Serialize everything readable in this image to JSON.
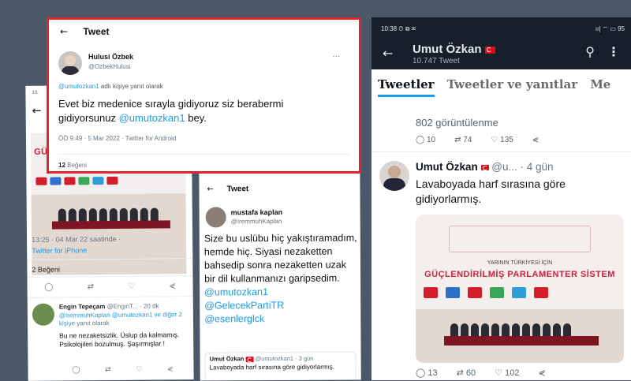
{
  "left_card": {
    "status_time": "13:",
    "back_icon": "←",
    "photo_banner": "GÜ",
    "time": "13:25 · 04 Mar 22 saatinde ·",
    "source": "Twitter for iPhone",
    "likes": "2 Beğeni",
    "reply": {
      "name": "Engin Tepeçam",
      "handle_date": "@EnginT... · 20 dk",
      "replying_prefix": "@IremmuhKaplan @umutozkan1 ve",
      "replying_more": "diğer 2 kişiye",
      "replying_suffix": " yanıt olarak",
      "text": "Bu ne nezaketsizlik. Üslup da kalmamış. Psikolojileri bozulmuş. Şaşırmışlar !"
    }
  },
  "top_card": {
    "header": "Tweet",
    "name": "Hulusi Özbek",
    "handle": "@OzbekHulusi",
    "replying_handle": "@umutozkan1",
    "replying_suffix": " adlı kişiye yanıt olarak",
    "body_text": "Evet biz medenice sırayla gidiyoruz siz berabermi gidiyorsunuz ",
    "body_mention": "@umutozkan1",
    "body_end": " bey.",
    "time": "ÖÖ 9:49 · 5 Mar 2022 · Twitter for Android",
    "likes_count": "12",
    "likes_label": " Beğeni"
  },
  "mid_card": {
    "header": "Tweet",
    "name": "mustafa kaplan",
    "handle": "@IremmuhKaplan",
    "body": "Size bu uslübu hiç yakıştıramadım, hemde hiç. Siyasi nezaketten bahsedip sonra nezaketten uzak bir dil kullanmanızı garipsedim.",
    "mention1": "@umutozkan1",
    "mention2": "@GelecekPartiTR",
    "mention3": "@esenlerglck",
    "quote": {
      "name": "Umut Özkan",
      "handle_date": "@umutozkan1 · 3 gün",
      "text": "Lavaboyada harf sırasına göre gidiyorlarmış."
    }
  },
  "right_card": {
    "status_left": "10:38 ⏱ ⧉ ✉",
    "status_right": "ıı| ⌔ ▭ 95",
    "profile_name": "Umut Özkan",
    "tweet_count": "10.747 Tweet",
    "tabs": [
      "Tweetler",
      "Tweetler ve yanıtlar",
      "Me"
    ],
    "views": "802 görüntülenme",
    "prev_actions": {
      "replies": "10",
      "retweets": "74",
      "likes": "135"
    },
    "tweet": {
      "name": "Umut Özkan",
      "handle_date": "@u... · 4 gün",
      "text": "Lavaboyada harf sırasına göre gidiyorlarmış.",
      "replies": "13",
      "retweets": "60",
      "likes": "102"
    },
    "media": {
      "subtitle": "YARININ TÜRKİYESİ İÇİN",
      "title": "GÜÇLENDİRİLMİŞ PARLAMENTER SİSTEM"
    }
  },
  "icons": {
    "back": "←",
    "reply": "◯",
    "retweet": "⇄",
    "like": "♡",
    "share": "⋞",
    "more": "···",
    "search": "⚲",
    "kebab": "⋮"
  },
  "colors": {
    "accent": "#1d9bf0",
    "highlight_border": "#e0262c",
    "dark_bg": "#15202b"
  }
}
